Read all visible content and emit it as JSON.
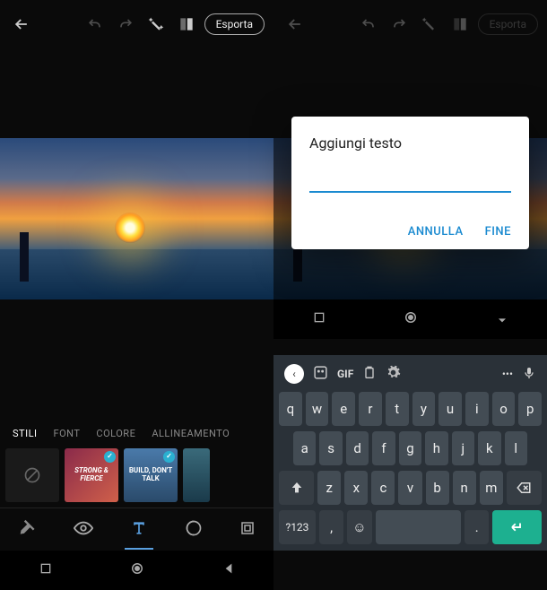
{
  "topbar": {
    "export_label": "Esporta"
  },
  "edit_tabs": {
    "styles": "STILI",
    "font": "FONT",
    "color": "COLORE",
    "align": "ALLINEAMENTO"
  },
  "style_presets": {
    "s1": "STRONG & FIERCE",
    "s2": "BUILD, DON'T TALK",
    "s3": ""
  },
  "dialog": {
    "title": "Aggiungi testo",
    "cancel": "ANNULLA",
    "done": "FINE"
  },
  "keyboard": {
    "gif": "GIF",
    "more": "•••",
    "row1": [
      "q",
      "w",
      "e",
      "r",
      "t",
      "y",
      "u",
      "i",
      "o",
      "p"
    ],
    "row2": [
      "a",
      "s",
      "d",
      "f",
      "g",
      "h",
      "j",
      "k",
      "l"
    ],
    "row3_mid": [
      "z",
      "x",
      "c",
      "v",
      "b",
      "n",
      "m"
    ],
    "sym": "?123",
    "comma": ",",
    "period": "."
  }
}
